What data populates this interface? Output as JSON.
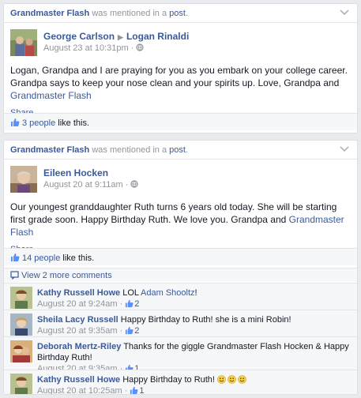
{
  "posts": [
    {
      "header": {
        "actor": "Grandmaster Flash",
        "mid_text": " was mentioned in a ",
        "post_link": "post",
        "end": "."
      },
      "author": "George Carlson",
      "target": "Logan Rinaldi",
      "time": "August 23 at 10:31pm",
      "text": "Logan, Grandpa and I are praying for you as you embark on your college career. Grandpa says to keep your nose clean and your spirits up. Love, Grandpa and ",
      "text_tag": "Grandmaster Flash",
      "share": "Share",
      "likes_link": "3 people",
      "likes_suffix": " like this."
    },
    {
      "header": {
        "actor": "Grandmaster Flash",
        "mid_text": " was mentioned in a ",
        "post_link": "post",
        "end": "."
      },
      "author": "Eileen Hocken",
      "time": "August 20 at 9:11am",
      "text": "Our youngest granddaughter Ruth turns 6 years old today. She will be starting first grade soon. Happy Birthday Ruth. We love you. Grandpa and ",
      "text_tag": "Grandmaster Flash",
      "share": "Share",
      "likes_link": "14 people",
      "likes_suffix": " like this.",
      "more_comments": "View 2 more comments",
      "comments": [
        {
          "author": "Kathy Russell Howe",
          "text": " LOL ",
          "tag": "Adam Shooltz",
          "text_end": "!",
          "time": "August 20 at 9:24am",
          "likes": "2"
        },
        {
          "author": "Sheila Lacy Russell",
          "text": " Happy Birthday to Ruth! she is a mini Robin!",
          "time": "August 20 at 9:35am",
          "likes": "2"
        },
        {
          "author": "Deborah Mertz-Riley",
          "text": " Thanks for the giggle Grandmaster Flash Hocken & Happy Birthday Ruth!",
          "time": "August 20 at 9:35am",
          "likes": "1"
        },
        {
          "author": "Kathy Russell Howe",
          "text": " Happy Birthday to Ruth! ",
          "time": "August 20 at 10:25am",
          "likes": "1"
        }
      ]
    }
  ],
  "colors": {
    "link": "#3b5998",
    "meta": "#90949c",
    "background": "#e9eaed"
  },
  "icons": [
    "chevron-down-icon",
    "globe-icon",
    "thumbs-up-icon",
    "smiley-icon"
  ]
}
